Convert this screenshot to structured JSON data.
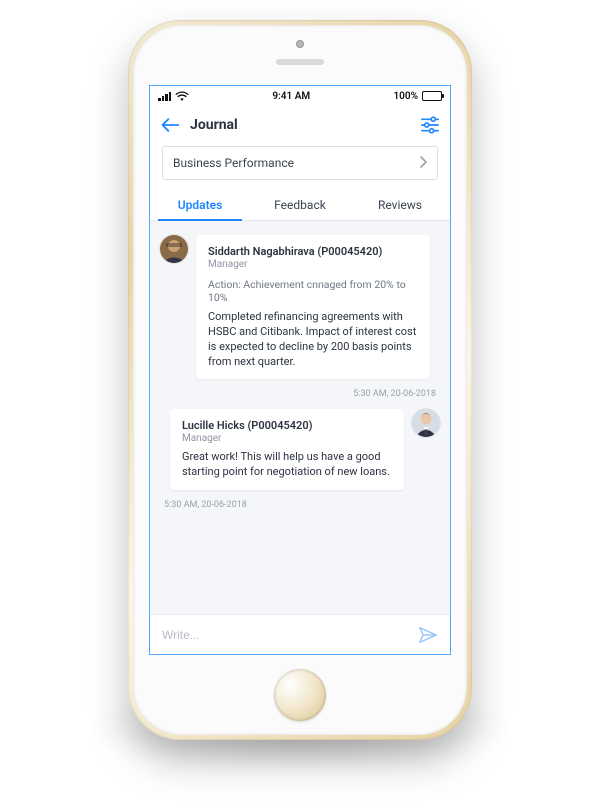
{
  "status": {
    "time": "9:41 AM",
    "battery_pct": "100%"
  },
  "header": {
    "title": "Journal"
  },
  "category": {
    "label": "Business Performance"
  },
  "tabs": {
    "updates": "Updates",
    "feedback": "Feedback",
    "reviews": "Reviews"
  },
  "messages": [
    {
      "name": "Siddarth Nagabhirava (P00045420)",
      "role": "Manager",
      "action": "Action: Achievement cnnaged from 20% to 10%",
      "body": "Completed refinancing agreements with HSBC and Citibank. Impact of interest cost is expected to decline by 200 basis points from next quarter.",
      "time": "5:30 AM, 20-06-2018"
    },
    {
      "name": "Lucille Hicks (P00045420)",
      "role": "Manager",
      "body": "Great work! This will help us have a good starting point for negotiation of new loans.",
      "time": "5:30 AM, 20-06-2018"
    }
  ],
  "composer": {
    "placeholder": "Write..."
  }
}
